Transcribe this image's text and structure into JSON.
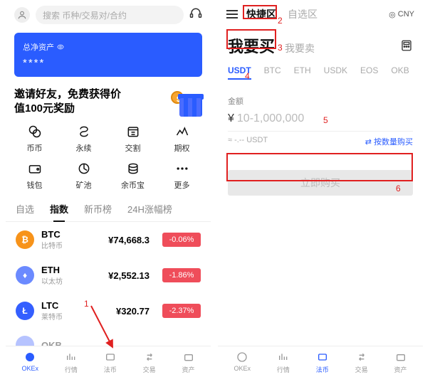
{
  "left": {
    "search_placeholder": "搜索 币种/交易对/合约",
    "asset_label": "总净资产",
    "asset_value": "****",
    "invite_line1": "邀请好友，免费获得价",
    "invite_line2": "值100元奖励",
    "grid": [
      {
        "label": "币币"
      },
      {
        "label": "永续"
      },
      {
        "label": "交割"
      },
      {
        "label": "期权"
      },
      {
        "label": "钱包"
      },
      {
        "label": "矿池"
      },
      {
        "label": "余币宝"
      },
      {
        "label": "更多"
      }
    ],
    "tabs": [
      "自选",
      "指数",
      "新币榜",
      "24H涨幅榜"
    ],
    "active_tab": 1,
    "coins": [
      {
        "sym": "BTC",
        "name": "比特币",
        "price": "¥74,668.3",
        "chg": "-0.06%"
      },
      {
        "sym": "ETH",
        "name": "以太坊",
        "price": "¥2,552.13",
        "chg": "-1.86%"
      },
      {
        "sym": "LTC",
        "name": "莱特币",
        "price": "¥320.77",
        "chg": "-2.37%"
      },
      {
        "sym": "OKB",
        "name": "",
        "price": "",
        "chg": ""
      }
    ],
    "nav": [
      "OKEx",
      "行情",
      "法币",
      "交易",
      "资产"
    ],
    "nav_active": 0
  },
  "right": {
    "tabs": [
      "快捷区",
      "自选区"
    ],
    "tabs_active": 0,
    "currency": "CNY",
    "buy_label": "我要买",
    "sell_label": "我要卖",
    "coins": [
      "USDT",
      "BTC",
      "ETH",
      "USDK",
      "EOS",
      "OKB"
    ],
    "coins_active": 0,
    "amount_label": "金额",
    "currency_symbol": "¥",
    "placeholder": "10-1,000,000",
    "approx": "≈ -.-- USDT",
    "byqty": "按数量购买",
    "button": "立即购买",
    "nav": [
      "OKEx",
      "行情",
      "法币",
      "交易",
      "资产"
    ],
    "nav_active": 2
  },
  "annotations": {
    "n1": "1",
    "n2": "2",
    "n3": "3",
    "n4": "4",
    "n5": "5",
    "n6": "6"
  }
}
